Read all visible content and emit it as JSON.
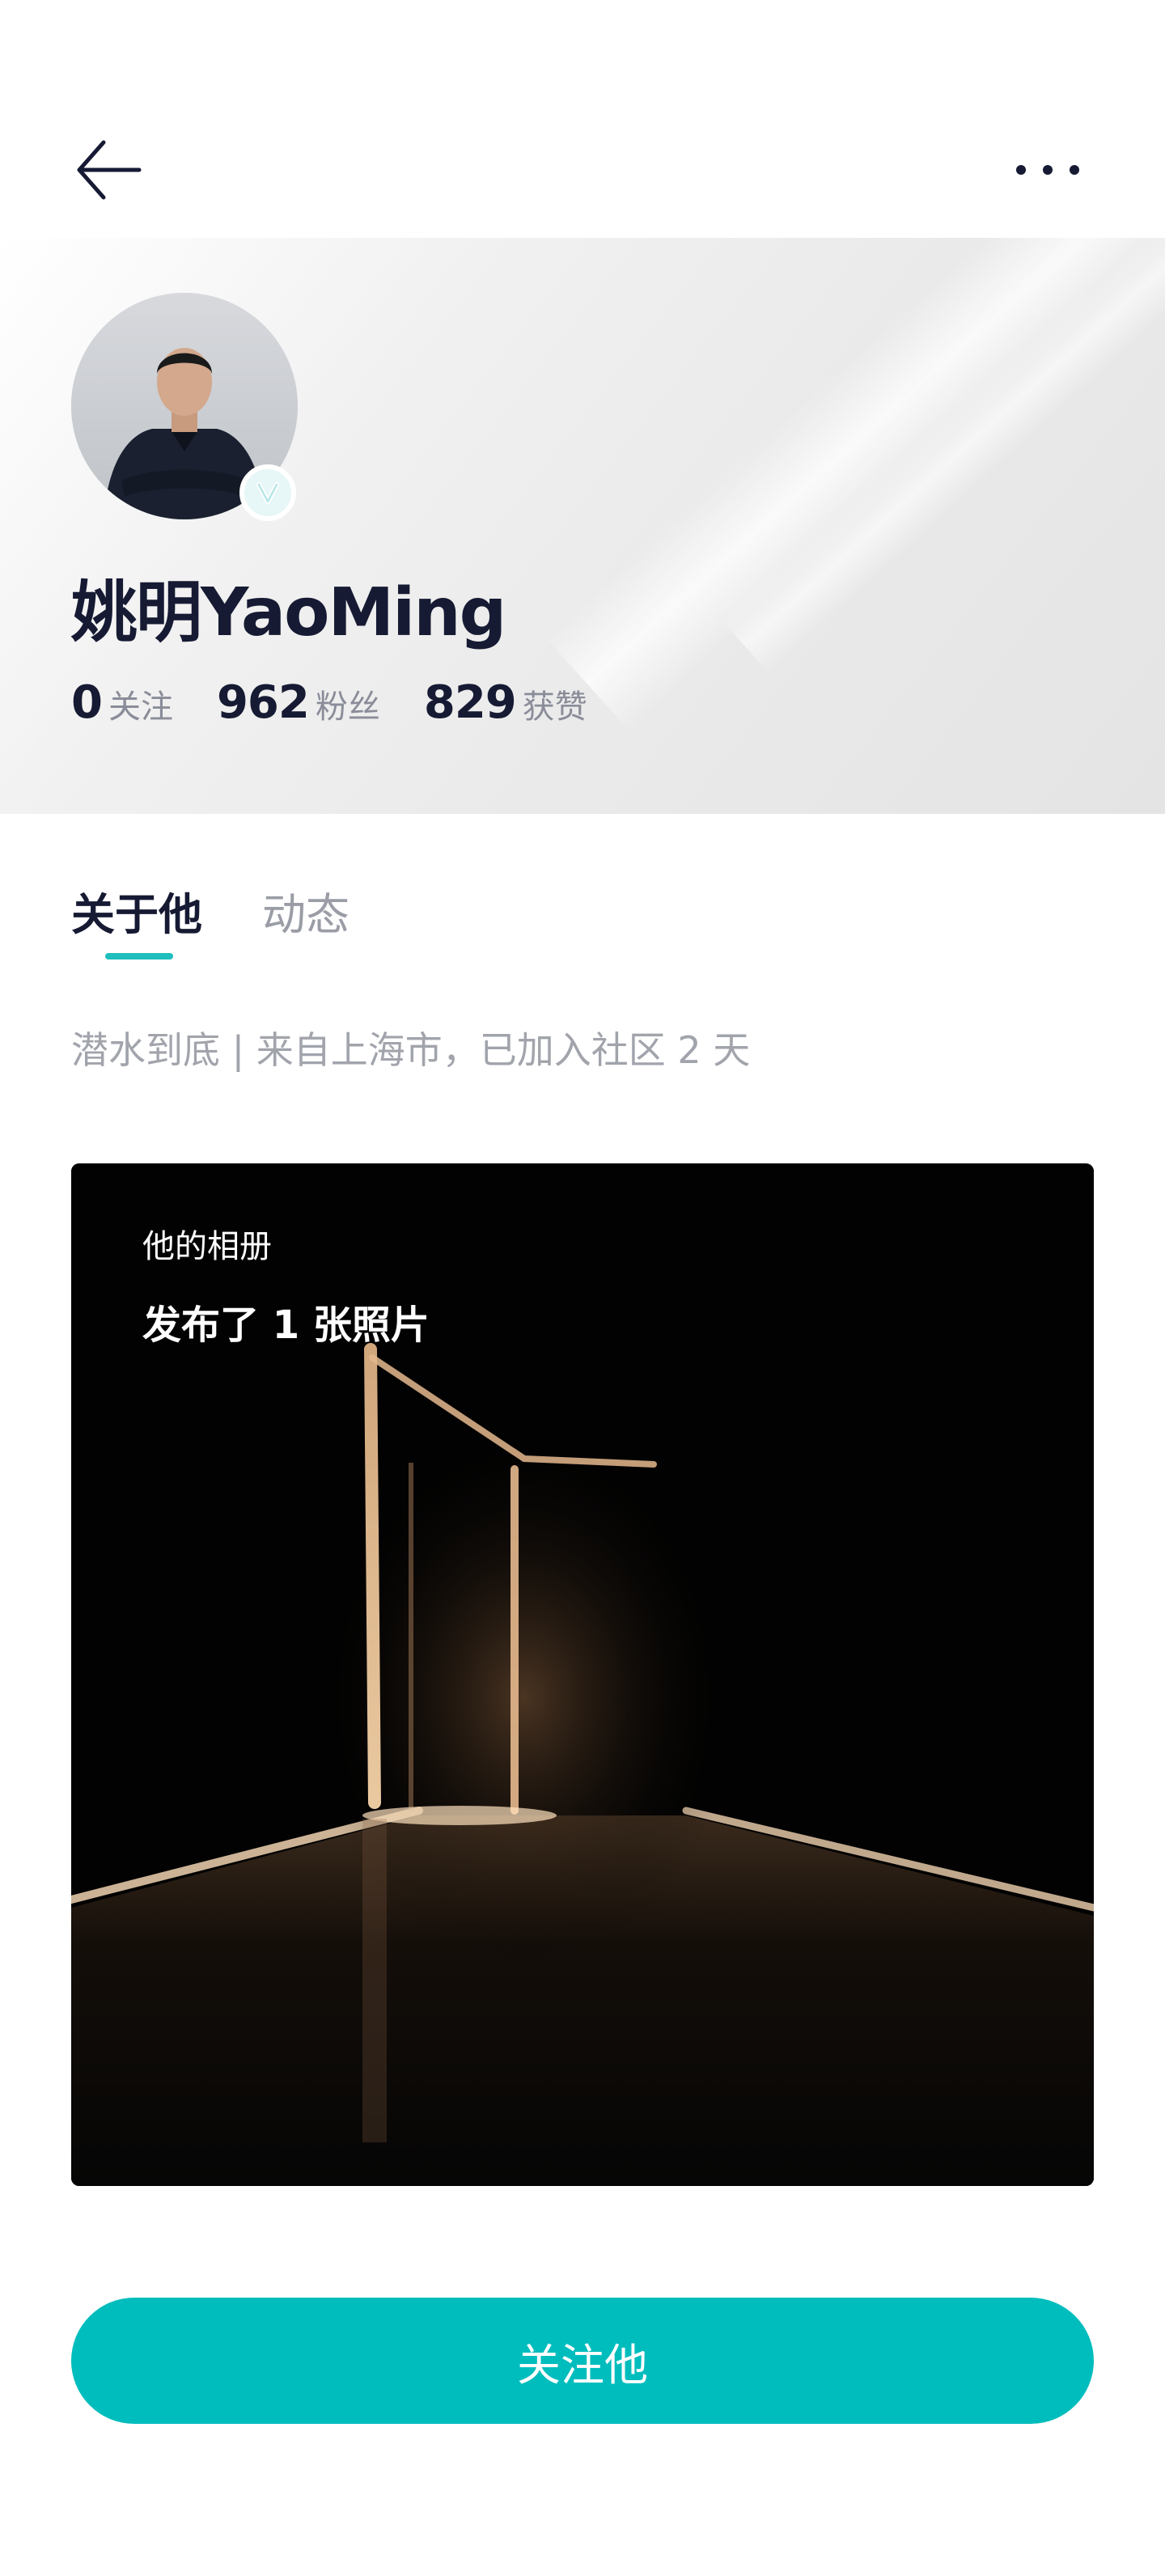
{
  "nav": {
    "back_icon": "arrow-left-icon",
    "more_icon": "ellipsis-icon"
  },
  "profile": {
    "name": "姚明YaoMing",
    "avatar_alt": "avatar",
    "verified_icon": "verified-v-icon",
    "stats": [
      {
        "value": "0",
        "label": "关注"
      },
      {
        "value": "962",
        "label": "粉丝"
      },
      {
        "value": "829",
        "label": "获赞"
      }
    ]
  },
  "tabs": [
    {
      "label": "关于他",
      "active": true
    },
    {
      "label": "动态",
      "active": false
    }
  ],
  "bio": "潜水到底 | 来自上海市，已加入社区 2 天",
  "album": {
    "label": "他的相册",
    "count_text": "发布了 1 张照片"
  },
  "follow_button": {
    "label": "关注他"
  },
  "colors": {
    "accent": "#00bdbd",
    "text_primary": "#161a33",
    "text_secondary": "#9a9da6"
  }
}
